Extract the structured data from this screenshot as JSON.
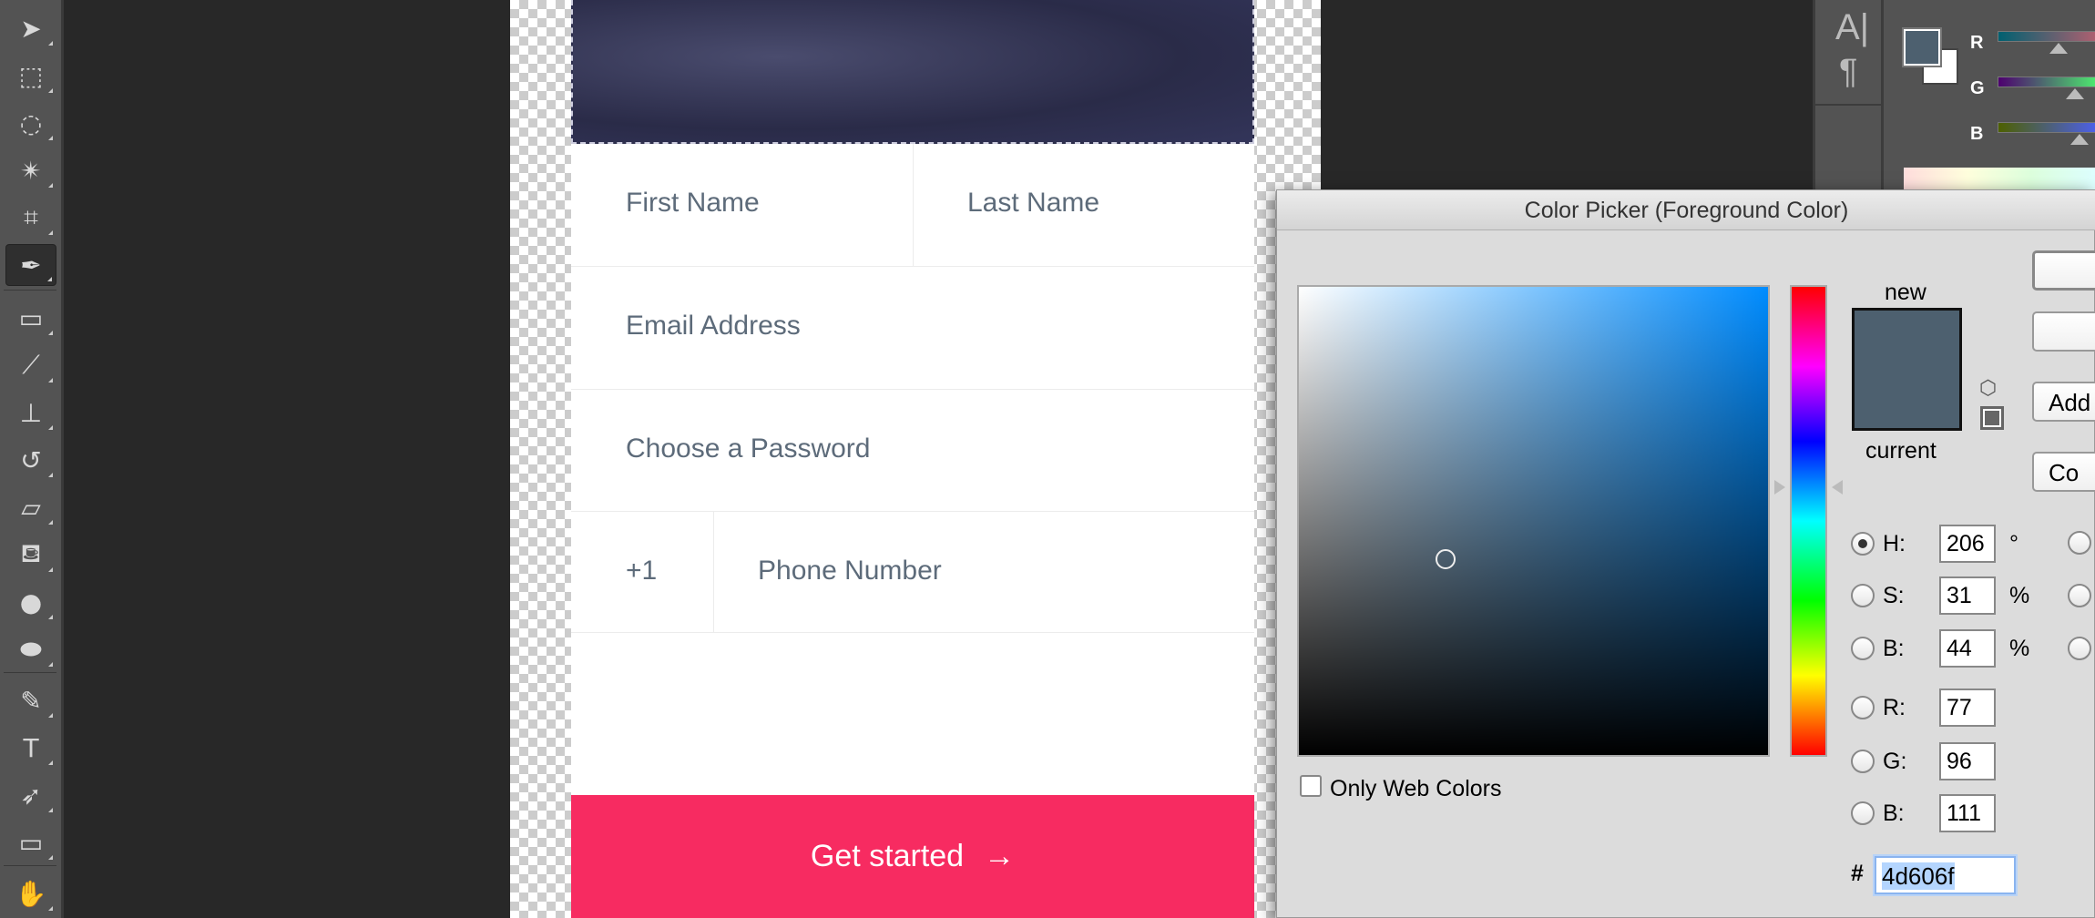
{
  "toolbar": {
    "tools": [
      {
        "name": "move",
        "glyph": "➤"
      },
      {
        "name": "marquee",
        "glyph": "⬚"
      },
      {
        "name": "lasso",
        "glyph": "◌"
      },
      {
        "name": "magic-wand",
        "glyph": "✴"
      },
      {
        "name": "crop",
        "glyph": "⌗"
      },
      {
        "name": "eyedropper",
        "glyph": "✒",
        "active": true
      },
      {
        "name": "healing-brush",
        "glyph": "▭"
      },
      {
        "name": "brush",
        "glyph": "⟋"
      },
      {
        "name": "clone-stamp",
        "glyph": "⊥"
      },
      {
        "name": "history-brush",
        "glyph": "↺"
      },
      {
        "name": "eraser",
        "glyph": "▱"
      },
      {
        "name": "paint-bucket",
        "glyph": "⛾"
      },
      {
        "name": "blur",
        "glyph": "●"
      },
      {
        "name": "sponge",
        "glyph": "⬬"
      },
      {
        "name": "pen",
        "glyph": "✎"
      },
      {
        "name": "type",
        "glyph": "T"
      },
      {
        "name": "path-selection",
        "glyph": "➶"
      },
      {
        "name": "rectangle",
        "glyph": "▭"
      },
      {
        "name": "hand",
        "glyph": "✋"
      }
    ]
  },
  "form": {
    "first_name": "First Name",
    "last_name": "Last Name",
    "email": "Email Address",
    "password": "Choose a Password",
    "country_code": "+1",
    "phone": "Phone Number",
    "cta": "Get started",
    "cta_arrow": "→",
    "cta_color": "#f72b61"
  },
  "panel": {
    "char_icon": "A|",
    "para_icon": "¶",
    "r": "R",
    "g": "G",
    "b": "B",
    "fg_color": "#4d606f"
  },
  "dialog": {
    "title": "Color Picker (Foreground Color)",
    "new_label": "new",
    "current_label": "current",
    "only_web": "Only Web Colors",
    "buttons": [
      "",
      "",
      "Add",
      "Co"
    ],
    "fields": [
      {
        "label": "H:",
        "value": "206",
        "unit": "°",
        "checked": true
      },
      {
        "label": "S:",
        "value": "31",
        "unit": "%"
      },
      {
        "label": "B:",
        "value": "44",
        "unit": "%"
      },
      {
        "label": "R:",
        "value": "77",
        "unit": ""
      },
      {
        "label": "G:",
        "value": "96",
        "unit": ""
      },
      {
        "label": "B:",
        "value": "111",
        "unit": ""
      }
    ],
    "hash": "#",
    "hex": "4d606f",
    "new_color": "#4d606f",
    "current_color": "#4d606f"
  }
}
